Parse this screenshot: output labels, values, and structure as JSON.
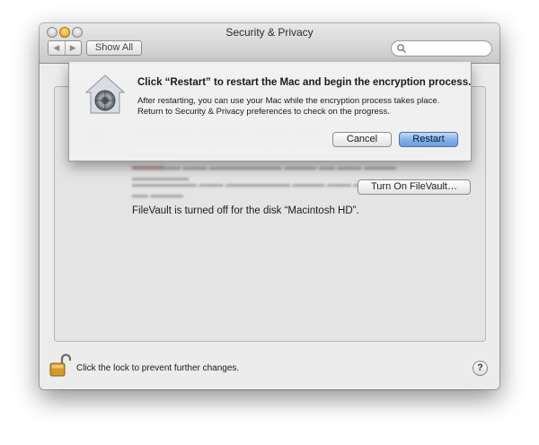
{
  "window": {
    "title": "Security & Privacy",
    "nav": {
      "back_label": "◀",
      "forward_label": "▶"
    },
    "show_all_label": "Show All"
  },
  "search": {
    "placeholder": "",
    "value": ""
  },
  "sheet": {
    "title": "Click “Restart” to restart the Mac and begin the encryption process.",
    "body": "After restarting, you can use your Mac while the encryption process takes place. Return to Security & Privacy preferences to check on the progress.",
    "cancel_label": "Cancel",
    "restart_label": "Restart"
  },
  "filevault": {
    "status_text": "FileVault is turned off for the disk “Macintosh HD”.",
    "turn_on_label": "Turn On FileVault…"
  },
  "footer": {
    "lock_text": "Click the lock to prevent further changes.",
    "help_label": "?"
  },
  "colors": {
    "default_button": "#6a9fe3",
    "warning_text": "#d98a8a",
    "window_bg": "#ececec"
  },
  "icons": {
    "lock": "padlock-open-icon",
    "sheet": "filevault-house-icon",
    "search": "magnifier-icon",
    "help": "question-mark-icon"
  }
}
